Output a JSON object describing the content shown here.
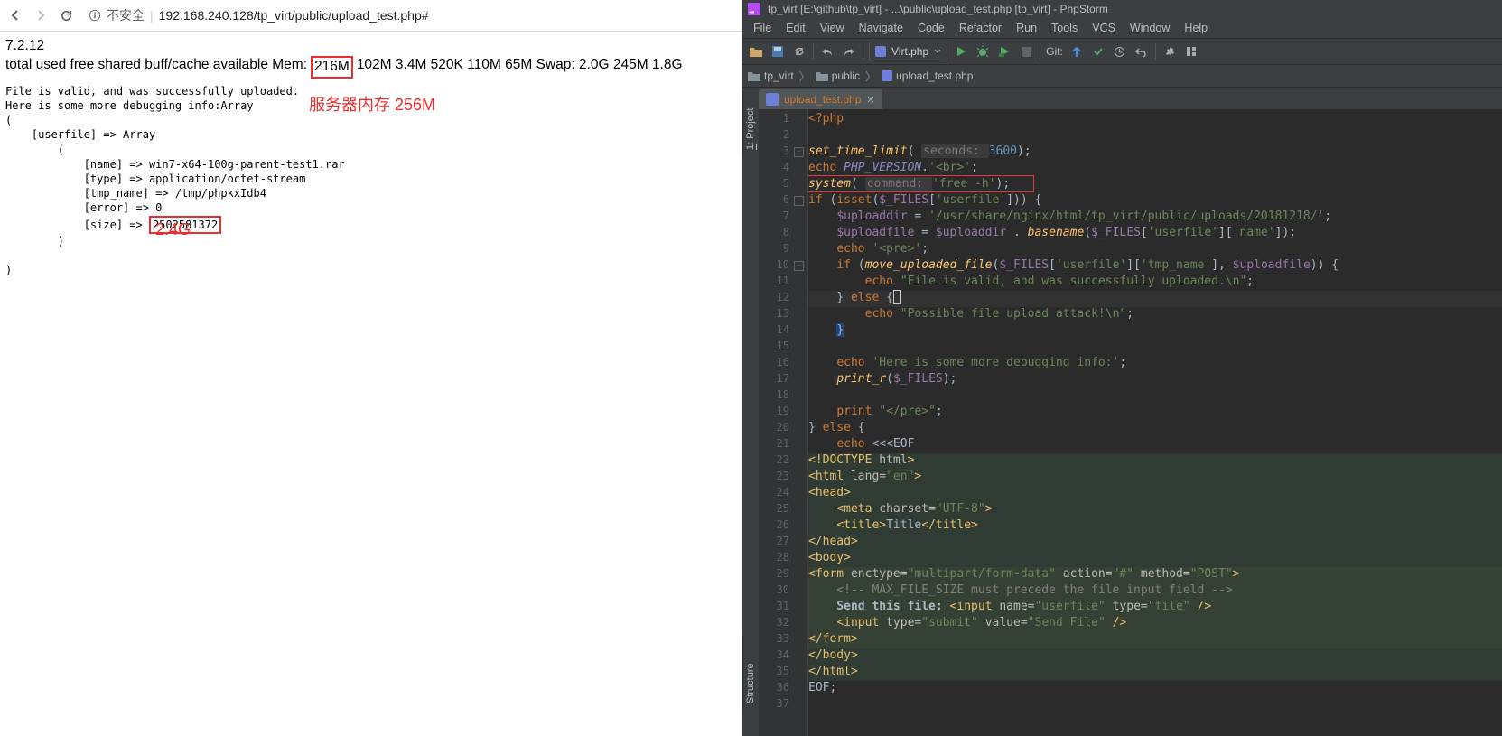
{
  "browser": {
    "insecure_label": "不安全",
    "url": "192.168.240.128/tp_virt/public/upload_test.php#",
    "page": {
      "php_version": "7.2.12",
      "mem_prefix": "total used free shared buff/cache available Mem:",
      "mem_boxed": "216M",
      "mem_rest": "102M 3.4M 520K 110M 65M Swap: 2.0G 245M 1.8G",
      "annotation_mem": "服务器内存 256M",
      "annotation_size": "2.4G",
      "pre_l1": "File is valid, and was successfully uploaded.",
      "pre_l2": "Here is some more debugging info:Array",
      "pre_l3": "(",
      "pre_l4": "    [userfile] => Array",
      "pre_l5": "        (",
      "pre_l6": "            [name] => win7-x64-100g-parent-test1.rar",
      "pre_l7": "            [type] => application/octet-stream",
      "pre_l8": "            [tmp_name] => /tmp/phpkxIdb4",
      "pre_l9": "            [error] => 0",
      "pre_l10a": "            [size] => ",
      "pre_l10b": "2502581372",
      "pre_l11": "        )",
      "pre_l12": "",
      "pre_l13": ")"
    }
  },
  "ide": {
    "title": "tp_virt [E:\\github\\tp_virt] - ...\\public\\upload_test.php [tp_virt] - PhpStorm",
    "menu": [
      "File",
      "Edit",
      "View",
      "Navigate",
      "Code",
      "Refactor",
      "Run",
      "Tools",
      "VCS",
      "Window",
      "Help"
    ],
    "run_config": "Virt.php",
    "git_label": "Git:",
    "breadcrumbs": [
      "tp_virt",
      "public",
      "upload_test.php"
    ],
    "tab_label": "upload_test.php",
    "side_project": "1: Project",
    "side_structure": "Structure",
    "lines": {
      "1": "<?php",
      "2": "",
      "3": "set_time_limit( seconds: 3600);",
      "4": "echo PHP_VERSION.'<br>';",
      "5": "system( command: 'free -h');",
      "6": "if (isset($_FILES['userfile'])) {",
      "7": "    $uploaddir = '/usr/share/nginx/html/tp_virt/public/uploads/20181218/';",
      "8": "    $uploadfile = $uploaddir . basename($_FILES['userfile']['name']);",
      "9": "    echo '<pre>';",
      "10": "    if (move_uploaded_file($_FILES['userfile']['tmp_name'], $uploadfile)) {",
      "11": "        echo \"File is valid, and was successfully uploaded.\\n\";",
      "12": "    } else {",
      "13": "        echo \"Possible file upload attack!\\n\";",
      "14": "    }",
      "15": "",
      "16": "    echo 'Here is some more debugging info:';",
      "17": "    print_r($_FILES);",
      "18": "",
      "19": "    print \"</pre>\";",
      "20": "} else {",
      "21": "    echo <<<EOF",
      "22": "<!DOCTYPE html>",
      "23": "<html lang=\"en\">",
      "24": "<head>",
      "25": "    <meta charset=\"UTF-8\">",
      "26": "    <title>Title</title>",
      "27": "</head>",
      "28": "<body>",
      "29": "<form enctype=\"multipart/form-data\" action=\"#\" method=\"POST\">",
      "30": "    <!-- MAX_FILE_SIZE must precede the file input field -->",
      "31": "    Send this file: <input name=\"userfile\" type=\"file\" />",
      "32": "    <input type=\"submit\" value=\"Send File\" />",
      "33": "</form>",
      "34": "</body>",
      "35": "</html>",
      "36": "EOF;",
      "37": ""
    }
  }
}
